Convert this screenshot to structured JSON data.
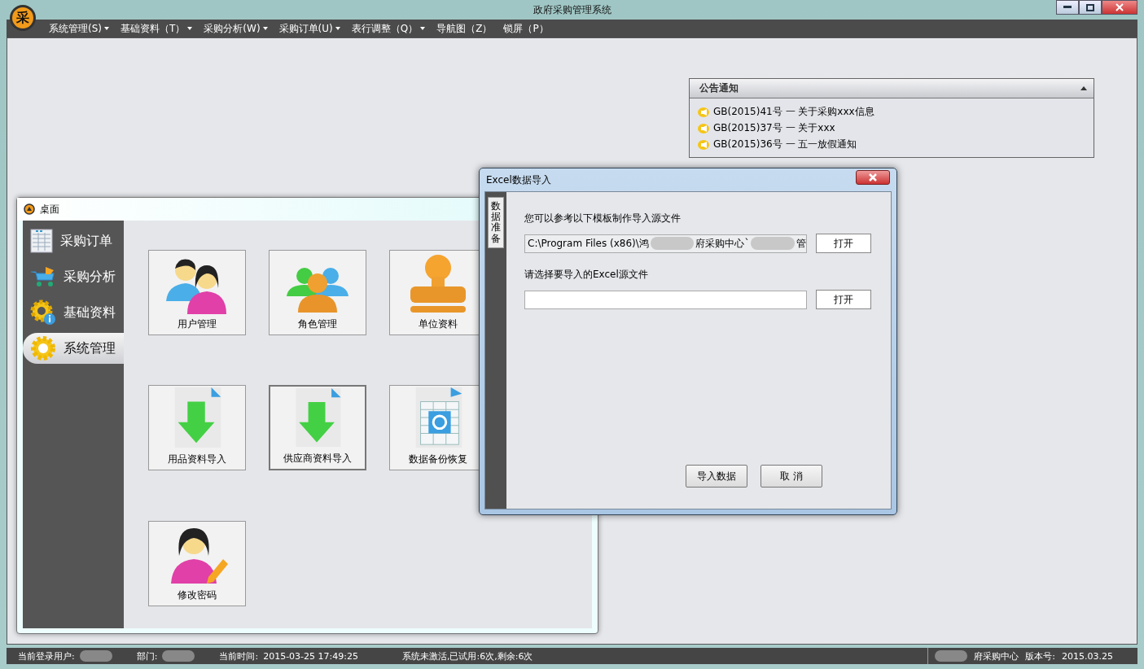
{
  "window": {
    "title": "政府采购管理系统",
    "logo": "采"
  },
  "menu": [
    {
      "label": "系统管理(S)",
      "dropdown": true
    },
    {
      "label": "基础资料（T）",
      "dropdown": true
    },
    {
      "label": "采购分析(W)",
      "dropdown": true
    },
    {
      "label": "采购订单(U)",
      "dropdown": true
    },
    {
      "label": "表行调整（Q）",
      "dropdown": true
    },
    {
      "label": "导航图（Z）",
      "dropdown": false
    },
    {
      "label": "锁屏（P）",
      "dropdown": false
    }
  ],
  "notice": {
    "title": "公告通知",
    "items": [
      "GB(2015)41号 一 关于采购xxx信息",
      "GB(2015)37号 一 关于xxx",
      "GB(2015)36号 一 五一放假通知"
    ]
  },
  "desktop": {
    "title": "桌面",
    "nav": [
      {
        "label": "采购订单",
        "kind": "sheet",
        "selected": false
      },
      {
        "label": "采购分析",
        "kind": "cart",
        "selected": false
      },
      {
        "label": "基础资料",
        "kind": "info",
        "selected": false
      },
      {
        "label": "系统管理",
        "kind": "gear",
        "selected": true
      }
    ],
    "tiles": [
      {
        "label": "用户管理",
        "kind": "users",
        "selected": false
      },
      {
        "label": "角色管理",
        "kind": "roles",
        "selected": false
      },
      {
        "label": "单位资料",
        "kind": "stamp",
        "selected": false
      },
      {
        "label": "用品资料导入",
        "kind": "import",
        "selected": false
      },
      {
        "label": "供应商资料导入",
        "kind": "import",
        "selected": true
      },
      {
        "label": "数据备份恢复",
        "kind": "backup",
        "selected": false
      },
      {
        "label": "修改密码",
        "kind": "password",
        "selected": false
      }
    ]
  },
  "dialog": {
    "title": "Excel数据导入",
    "side_tab": "数据准备",
    "template_label": "您可以参考以下模板制作导入源文件",
    "template_path": [
      "C:\\Program Files (x86)\\鸿",
      "府采购中心`",
      "管"
    ],
    "template_button": "打开",
    "source_label": "请选择要导入的Excel源文件",
    "source_button": "打开",
    "buttons": [
      "导入数据",
      "取 消"
    ]
  },
  "status_bar": {
    "user_label": "当前登录用户:",
    "dept_label": "部门:",
    "time_label": "当前时间:",
    "time": "2015-03-25 17:49:25",
    "activation": "系统未激活,已试用:6次,剩余:6次",
    "org": "府采购中心",
    "version_label": "版本号:",
    "version": "2015.03.25"
  }
}
